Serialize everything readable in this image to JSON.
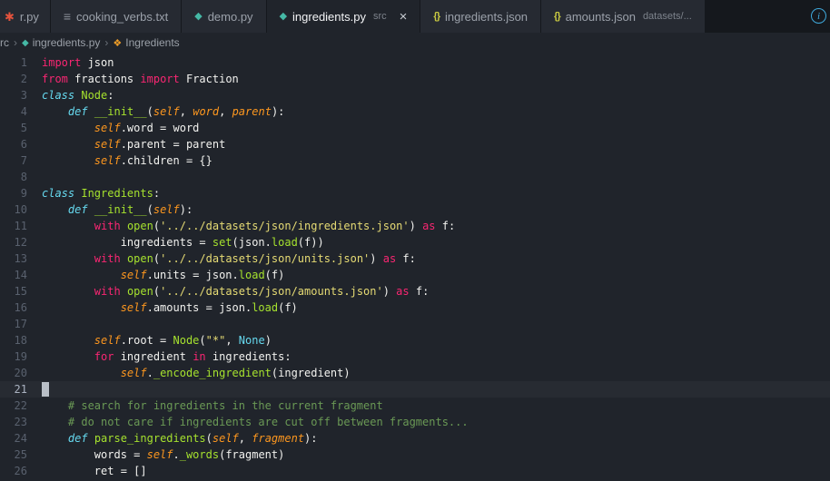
{
  "tab_bar": {
    "info_glyph": "i",
    "tabs": [
      {
        "label": "r.py",
        "icon": "file-orange",
        "glyph": "✱"
      },
      {
        "label": "cooking_verbs.txt",
        "icon": "text-file",
        "glyph": "≡"
      },
      {
        "label": "demo.py",
        "icon": "python",
        "glyph": "◆"
      },
      {
        "label": "ingredients.py",
        "icon": "python",
        "glyph": "◆",
        "description": "src",
        "active": true,
        "close_glyph": "×"
      },
      {
        "label": "ingredients.json",
        "icon": "json",
        "glyph": "{}"
      },
      {
        "label": "amounts.json",
        "icon": "json",
        "glyph": "{}",
        "description": "datasets/..."
      }
    ]
  },
  "breadcrumb": {
    "separator": "›",
    "items": [
      {
        "label": "src"
      },
      {
        "label": "ingredients.py",
        "icon": "python",
        "glyph": "◆"
      },
      {
        "label": "Ingredients",
        "icon": "symbol-class",
        "glyph": "❖"
      }
    ]
  },
  "editor": {
    "language": "python",
    "cursor_line": 21,
    "token_colors": {
      "keyword": "#f92672",
      "storage": "#66d9ef",
      "function": "#a6e22e",
      "parameter": "#fd971f",
      "string": "#e6db74",
      "comment": "#6a9955",
      "constant": "#66d9ef",
      "plain": "#f2f2ef",
      "background": "#20242b"
    },
    "lines": [
      {
        "n": 1,
        "t": [
          [
            "k",
            "import"
          ],
          [
            "w",
            " json"
          ]
        ]
      },
      {
        "n": 2,
        "t": [
          [
            "k",
            "from"
          ],
          [
            "w",
            " fractions "
          ],
          [
            "k",
            "import"
          ],
          [
            "w",
            " Fraction"
          ]
        ]
      },
      {
        "n": 3,
        "t": [
          [
            "s",
            "class"
          ],
          [
            "w",
            " "
          ],
          [
            "f",
            "Node"
          ],
          [
            "w",
            ":"
          ]
        ]
      },
      {
        "n": 4,
        "t": [
          [
            "w",
            "    "
          ],
          [
            "s",
            "def"
          ],
          [
            "w",
            " "
          ],
          [
            "f",
            "__init__"
          ],
          [
            "w",
            "("
          ],
          [
            "p",
            "self"
          ],
          [
            "w",
            ", "
          ],
          [
            "p",
            "word"
          ],
          [
            "w",
            ", "
          ],
          [
            "p",
            "parent"
          ],
          [
            "w",
            "):"
          ]
        ]
      },
      {
        "n": 5,
        "t": [
          [
            "w",
            "        "
          ],
          [
            "p",
            "self"
          ],
          [
            "w",
            ".word = word"
          ]
        ]
      },
      {
        "n": 6,
        "t": [
          [
            "w",
            "        "
          ],
          [
            "p",
            "self"
          ],
          [
            "w",
            ".parent = parent"
          ]
        ]
      },
      {
        "n": 7,
        "t": [
          [
            "w",
            "        "
          ],
          [
            "p",
            "self"
          ],
          [
            "w",
            ".children = {}"
          ]
        ]
      },
      {
        "n": 8,
        "t": []
      },
      {
        "n": 9,
        "t": [
          [
            "s",
            "class"
          ],
          [
            "w",
            " "
          ],
          [
            "f",
            "Ingredients"
          ],
          [
            "w",
            ":"
          ]
        ]
      },
      {
        "n": 10,
        "t": [
          [
            "w",
            "    "
          ],
          [
            "s",
            "def"
          ],
          [
            "w",
            " "
          ],
          [
            "f",
            "__init__"
          ],
          [
            "w",
            "("
          ],
          [
            "p",
            "self"
          ],
          [
            "w",
            "):"
          ]
        ]
      },
      {
        "n": 11,
        "t": [
          [
            "w",
            "        "
          ],
          [
            "k",
            "with"
          ],
          [
            "w",
            " "
          ],
          [
            "f",
            "open"
          ],
          [
            "w",
            "("
          ],
          [
            "str",
            "'../../datasets/json/ingredients.json'"
          ],
          [
            "w",
            ") "
          ],
          [
            "k",
            "as"
          ],
          [
            "w",
            " f:"
          ]
        ]
      },
      {
        "n": 12,
        "t": [
          [
            "w",
            "            ingredients = "
          ],
          [
            "f",
            "set"
          ],
          [
            "w",
            "(json."
          ],
          [
            "f",
            "load"
          ],
          [
            "w",
            "(f))"
          ]
        ]
      },
      {
        "n": 13,
        "t": [
          [
            "w",
            "        "
          ],
          [
            "k",
            "with"
          ],
          [
            "w",
            " "
          ],
          [
            "f",
            "open"
          ],
          [
            "w",
            "("
          ],
          [
            "str",
            "'../../datasets/json/units.json'"
          ],
          [
            "w",
            ") "
          ],
          [
            "k",
            "as"
          ],
          [
            "w",
            " f:"
          ]
        ]
      },
      {
        "n": 14,
        "t": [
          [
            "w",
            "            "
          ],
          [
            "p",
            "self"
          ],
          [
            "w",
            ".units = json."
          ],
          [
            "f",
            "load"
          ],
          [
            "w",
            "(f)"
          ]
        ]
      },
      {
        "n": 15,
        "t": [
          [
            "w",
            "        "
          ],
          [
            "k",
            "with"
          ],
          [
            "w",
            " "
          ],
          [
            "f",
            "open"
          ],
          [
            "w",
            "("
          ],
          [
            "str",
            "'../../datasets/json/amounts.json'"
          ],
          [
            "w",
            ") "
          ],
          [
            "k",
            "as"
          ],
          [
            "w",
            " f:"
          ]
        ]
      },
      {
        "n": 16,
        "t": [
          [
            "w",
            "            "
          ],
          [
            "p",
            "self"
          ],
          [
            "w",
            ".amounts = json."
          ],
          [
            "f",
            "load"
          ],
          [
            "w",
            "(f)"
          ]
        ]
      },
      {
        "n": 17,
        "t": []
      },
      {
        "n": 18,
        "t": [
          [
            "w",
            "        "
          ],
          [
            "p",
            "self"
          ],
          [
            "w",
            ".root = "
          ],
          [
            "f",
            "Node"
          ],
          [
            "w",
            "("
          ],
          [
            "str",
            "\"*\""
          ],
          [
            "w",
            ", "
          ],
          [
            "b",
            "None"
          ],
          [
            "w",
            ")"
          ]
        ]
      },
      {
        "n": 19,
        "t": [
          [
            "w",
            "        "
          ],
          [
            "k",
            "for"
          ],
          [
            "w",
            " ingredient "
          ],
          [
            "k",
            "in"
          ],
          [
            "w",
            " ingredients:"
          ]
        ]
      },
      {
        "n": 20,
        "t": [
          [
            "w",
            "            "
          ],
          [
            "p",
            "self"
          ],
          [
            "w",
            "."
          ],
          [
            "f",
            "_encode_ingredient"
          ],
          [
            "w",
            "(ingredient)"
          ]
        ]
      },
      {
        "n": 21,
        "t": []
      },
      {
        "n": 22,
        "t": [
          [
            "w",
            "    "
          ],
          [
            "c",
            "# search for ingredients in the current fragment"
          ]
        ]
      },
      {
        "n": 23,
        "t": [
          [
            "w",
            "    "
          ],
          [
            "c",
            "# do not care if ingredients are cut off between fragments..."
          ]
        ]
      },
      {
        "n": 24,
        "t": [
          [
            "w",
            "    "
          ],
          [
            "s",
            "def"
          ],
          [
            "w",
            " "
          ],
          [
            "f",
            "parse_ingredients"
          ],
          [
            "w",
            "("
          ],
          [
            "p",
            "self"
          ],
          [
            "w",
            ", "
          ],
          [
            "p",
            "fragment"
          ],
          [
            "w",
            "):"
          ]
        ]
      },
      {
        "n": 25,
        "t": [
          [
            "w",
            "        words = "
          ],
          [
            "p",
            "self"
          ],
          [
            "w",
            "."
          ],
          [
            "f",
            "_words"
          ],
          [
            "w",
            "(fragment)"
          ]
        ]
      },
      {
        "n": 26,
        "t": [
          [
            "w",
            "        ret = []"
          ]
        ]
      }
    ]
  }
}
